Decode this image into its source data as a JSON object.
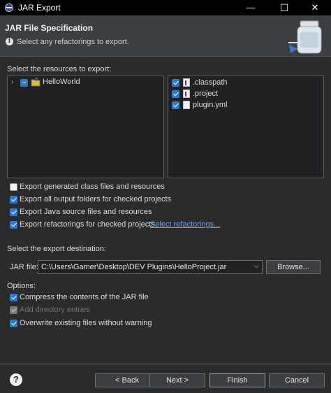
{
  "window": {
    "title": "JAR Export",
    "minimize": "—",
    "maximize": "☐",
    "close": "✕"
  },
  "banner": {
    "title": "JAR File Specification",
    "subtitle": "Select any refactorings to export."
  },
  "resources": {
    "label": "Select the resources to export:",
    "tree": [
      {
        "label": "HelloWorld",
        "checked": "partial",
        "expanded": false
      }
    ],
    "files": [
      {
        "label": ".classpath",
        "checked": true
      },
      {
        "label": ".project",
        "checked": true
      },
      {
        "label": "plugin.yml",
        "checked": true
      }
    ]
  },
  "export_options": [
    {
      "label": "Export generated class files and resources",
      "checked": false
    },
    {
      "label": "Export all output folders for checked projects",
      "checked": true
    },
    {
      "label": "Export Java source files and resources",
      "checked": true
    },
    {
      "label": "Export refactorings for checked projects.",
      "checked": true
    }
  ],
  "select_refactorings_link": "Select refactorings...",
  "destination": {
    "label": "Select the export destination:",
    "jar_file_label": "JAR file:",
    "jar_file_value": "C:\\Users\\Gamer\\Desktop\\DEV Plugins\\HelloProject.jar",
    "browse_label": "Browse..."
  },
  "options": {
    "label": "Options:",
    "items": [
      {
        "label": "Compress the contents of the JAR file",
        "checked": true,
        "enabled": true
      },
      {
        "label": "Add directory entries",
        "checked": true,
        "enabled": false
      },
      {
        "label": "Overwrite existing files without warning",
        "checked": true,
        "enabled": true
      }
    ]
  },
  "buttons": {
    "back": "< Back",
    "next": "Next >",
    "finish": "Finish",
    "cancel": "Cancel"
  },
  "help": "?"
}
